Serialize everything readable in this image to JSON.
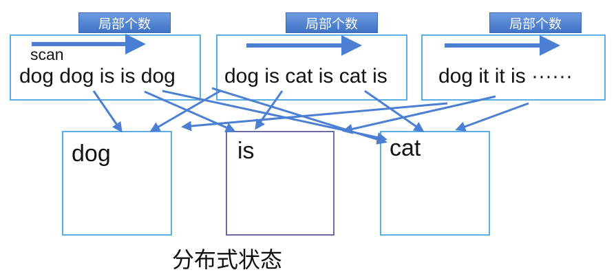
{
  "partitions": [
    {
      "tag": "局部个数",
      "text": "dog dog is is dog"
    },
    {
      "tag": "局部个数",
      "text": "dog is cat is cat is"
    },
    {
      "tag": "局部个数",
      "text": "dog it it is ······"
    }
  ],
  "scan_label": "scan",
  "buckets": [
    {
      "label": "dog"
    },
    {
      "label": "is"
    },
    {
      "label": "cat"
    }
  ],
  "caption": "分布式状态",
  "colors": {
    "arrow": "#4a7fd4",
    "box_border": "#5aaee6",
    "mid_bucket_border": "#6c6aa8",
    "tag_fill": "#4f82cf"
  }
}
